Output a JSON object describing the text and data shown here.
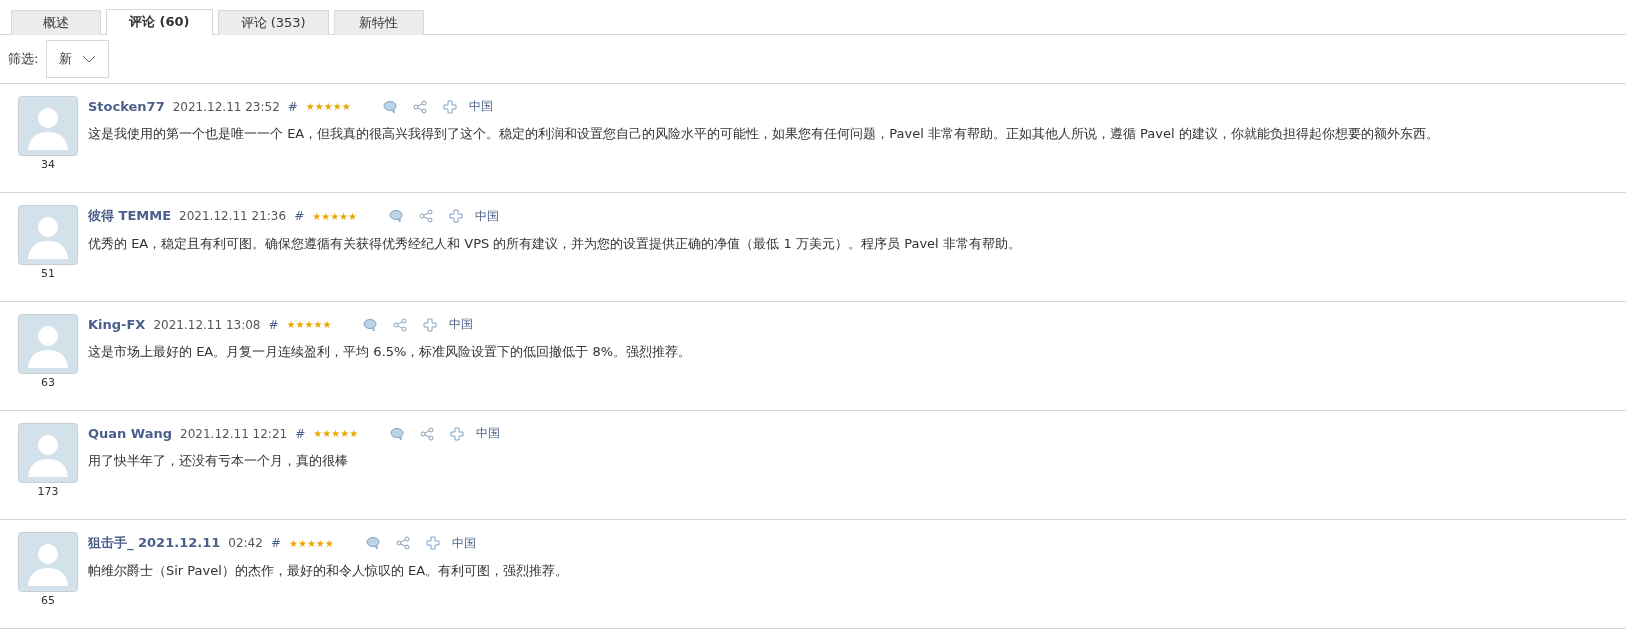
{
  "tabs": [
    {
      "label": "概述",
      "selected": false
    },
    {
      "label": "评论 (60)",
      "selected": true
    },
    {
      "label": "评论 (353)",
      "selected": false
    },
    {
      "label": "新特性",
      "selected": false
    }
  ],
  "filter": {
    "label": "筛选:",
    "value": "新"
  },
  "reviews": [
    {
      "author": "Stocken77",
      "date": "2021.12.11 23:52",
      "hash": "#",
      "stars": 5,
      "country": "中国",
      "count": "34",
      "text": "这是我使用的第一个也是唯一一个 EA，但我真的很高兴我得到了这个。稳定的利润和设置您自己的风险水平的可能性，如果您有任何问题，Pavel 非常有帮助。正如其他人所说，遵循 Pavel 的建议，你就能负担得起你想要的额外东西。"
    },
    {
      "author": "彼得 TEMME",
      "date": "2021.12.11 21:36",
      "hash": "#",
      "stars": 5,
      "country": "中国",
      "count": "51",
      "text": "优秀的 EA，稳定且有利可图。确保您遵循有关获得优秀经纪人和 VPS 的所有建议，并为您的设置提供正确的净值（最低 1 万美元）。程序员 Pavel 非常有帮助。"
    },
    {
      "author": "King-FX",
      "date": "2021.12.11 13:08",
      "hash": "#",
      "stars": 5,
      "country": "中国",
      "count": "63",
      "text": "这是市场上最好的 EA。月复一月连续盈利，平均 6.5%，标准风险设置下的低回撤低于 8%。强烈推荐。"
    },
    {
      "author": "Quan Wang",
      "date": "2021.12.11 12:21",
      "hash": "#",
      "stars": 5,
      "country": "中国",
      "count": "173",
      "text": "用了快半年了，还没有亏本一个月，真的很棒"
    },
    {
      "author": "狙击手_ 2021.12.11",
      "date": "02:42",
      "hash": "#",
      "stars": 5,
      "country": "中国",
      "count": "65",
      "text": "帕维尔爵士（Sir Pavel）的杰作，最好的和令人惊叹的 EA。有利可图，强烈推荐。"
    }
  ]
}
